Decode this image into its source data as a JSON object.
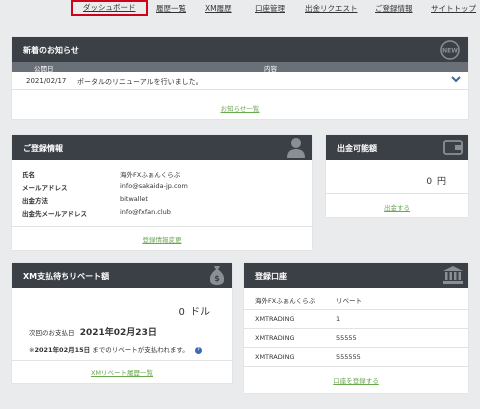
{
  "nav": {
    "items": [
      "ダッシュボード",
      "履歴一覧",
      "XM履歴",
      "口座管理",
      "出金リクエスト",
      "ご登録情報",
      "サイトトップ"
    ],
    "active_index": 0
  },
  "news": {
    "title": "新着のお知らせ",
    "icon": "new-badge-icon",
    "col_date": "公開日",
    "col_content": "内容",
    "rows": [
      {
        "date": "2021/02/17",
        "content": "ポータルのリニューアルを行いました。"
      }
    ],
    "more_link": "お知らせ一覧"
  },
  "registration": {
    "title": "ご登録情報",
    "icon": "user-icon",
    "fields": [
      {
        "label": "氏名",
        "value": "海外FXふぁんくらぶ"
      },
      {
        "label": "メールアドレス",
        "value": "info@sakaida-jp.com"
      },
      {
        "label": "出金方法",
        "value": "bitwallet"
      },
      {
        "label": "出金先メールアドレス",
        "value": "info@fxfan.club"
      }
    ],
    "edit_link": "登録情報変更"
  },
  "withdrawable": {
    "title": "出金可能額",
    "icon": "wallet-icon",
    "amount": "0",
    "unit": "円",
    "action_link": "出金する"
  },
  "rebate": {
    "title": "XM支払待ちリベート額",
    "icon": "money-bag-icon",
    "amount": "0",
    "unit": "ドル",
    "next_label": "次回のお支払日",
    "next_date": "2021年02月23日",
    "note_prefix": "※",
    "note_date": "2021年02月15日",
    "note_text": "までのリベートが支払われます。",
    "history_link": "XMリベート履歴一覧"
  },
  "accounts": {
    "title": "登録口座",
    "icon": "bank-icon",
    "rows": [
      {
        "name": "海外FXふぁんくらぶ",
        "value": "リベート"
      },
      {
        "name": "XMTRADING",
        "value": "1"
      },
      {
        "name": "XMTRADING",
        "value": "55555"
      },
      {
        "name": "XMTRADING",
        "value": "555555"
      }
    ],
    "register_link": "口座を登録する"
  }
}
